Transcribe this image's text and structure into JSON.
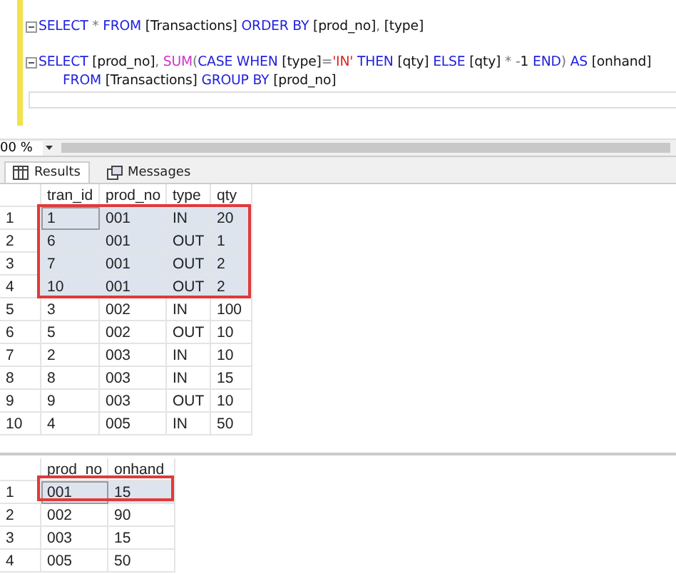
{
  "editor": {
    "lines": [
      {
        "kind": "statement",
        "tokens": [
          {
            "text": "SELECT",
            "kind": "keyword"
          },
          {
            "text": " * ",
            "kind": "operator"
          },
          {
            "text": "FROM",
            "kind": "keyword"
          },
          {
            "text": " [Transactions] ",
            "kind": "ident"
          },
          {
            "text": "ORDER BY",
            "kind": "keyword"
          },
          {
            "text": " [prod_no]",
            "kind": "ident"
          },
          {
            "text": ", ",
            "kind": "operator"
          },
          {
            "text": "[type]",
            "kind": "ident"
          }
        ]
      },
      {
        "kind": "blank"
      },
      {
        "kind": "statement",
        "tokens": [
          {
            "text": "SELECT",
            "kind": "keyword"
          },
          {
            "text": " [prod_no]",
            "kind": "ident"
          },
          {
            "text": ", ",
            "kind": "operator"
          },
          {
            "text": "SUM",
            "kind": "function"
          },
          {
            "text": "(",
            "kind": "operator"
          },
          {
            "text": "CASE WHEN",
            "kind": "keyword"
          },
          {
            "text": " [type]",
            "kind": "ident"
          },
          {
            "text": "=",
            "kind": "operator"
          },
          {
            "text": "'IN'",
            "kind": "string"
          },
          {
            "text": " THEN",
            "kind": "keyword"
          },
          {
            "text": " [qty] ",
            "kind": "ident"
          },
          {
            "text": "ELSE",
            "kind": "keyword"
          },
          {
            "text": " [qty] ",
            "kind": "ident"
          },
          {
            "text": "* -",
            "kind": "operator"
          },
          {
            "text": "1 ",
            "kind": "ident"
          },
          {
            "text": "END",
            "kind": "keyword"
          },
          {
            "text": ") ",
            "kind": "operator"
          },
          {
            "text": "AS",
            "kind": "keyword"
          },
          {
            "text": " [onhand]",
            "kind": "ident"
          }
        ]
      },
      {
        "kind": "continuation",
        "tokens": [
          {
            "text": "FROM",
            "kind": "keyword"
          },
          {
            "text": " [Transactions] ",
            "kind": "ident"
          },
          {
            "text": "GROUP BY",
            "kind": "keyword"
          },
          {
            "text": " [prod_no]",
            "kind": "ident"
          }
        ]
      }
    ]
  },
  "zoom": "00 %",
  "tabs": [
    {
      "label": "Results",
      "selected": true
    },
    {
      "label": "Messages",
      "selected": false
    }
  ],
  "grids": [
    {
      "columns": [
        "tran_id",
        "prod_no",
        "type",
        "qty"
      ],
      "rows": [
        {
          "num": "1",
          "cells": [
            "1",
            "001",
            "IN",
            "20"
          ],
          "highlighted": true
        },
        {
          "num": "2",
          "cells": [
            "6",
            "001",
            "OUT",
            "1"
          ],
          "highlighted": true
        },
        {
          "num": "3",
          "cells": [
            "7",
            "001",
            "OUT",
            "2"
          ],
          "highlighted": true
        },
        {
          "num": "4",
          "cells": [
            "10",
            "001",
            "OUT",
            "2"
          ],
          "highlighted": true
        },
        {
          "num": "5",
          "cells": [
            "3",
            "002",
            "IN",
            "100"
          ],
          "highlighted": false
        },
        {
          "num": "6",
          "cells": [
            "5",
            "002",
            "OUT",
            "10"
          ],
          "highlighted": false
        },
        {
          "num": "7",
          "cells": [
            "2",
            "003",
            "IN",
            "10"
          ],
          "highlighted": false
        },
        {
          "num": "8",
          "cells": [
            "8",
            "003",
            "IN",
            "15"
          ],
          "highlighted": false
        },
        {
          "num": "9",
          "cells": [
            "9",
            "003",
            "OUT",
            "10"
          ],
          "highlighted": false
        },
        {
          "num": "10",
          "cells": [
            "4",
            "005",
            "IN",
            "50"
          ],
          "highlighted": false
        }
      ]
    },
    {
      "columns": [
        "prod_no",
        "onhand"
      ],
      "rows": [
        {
          "num": "1",
          "cells": [
            "001",
            "15"
          ],
          "highlighted": true
        },
        {
          "num": "2",
          "cells": [
            "002",
            "90"
          ],
          "highlighted": false
        },
        {
          "num": "3",
          "cells": [
            "003",
            "15"
          ],
          "highlighted": false
        },
        {
          "num": "4",
          "cells": [
            "005",
            "50"
          ],
          "highlighted": false
        }
      ]
    }
  ]
}
